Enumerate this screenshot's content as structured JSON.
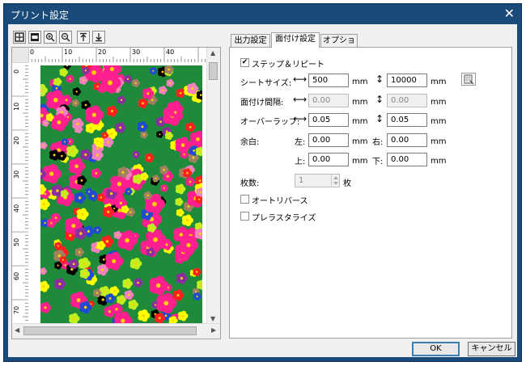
{
  "window": {
    "title": "プリント設定"
  },
  "toolbar": {
    "icons": [
      "fit-page-icon",
      "fit-width-icon",
      "zoom-in-icon",
      "zoom-out-icon",
      "align-top-icon",
      "align-bottom-icon"
    ]
  },
  "ruler": {
    "h_labels": [
      "0",
      "10",
      "20",
      "30",
      "40"
    ],
    "v_labels": [
      "0",
      "10",
      "20",
      "30",
      "40",
      "50",
      "60",
      "70"
    ]
  },
  "tabs": [
    {
      "label": "出力設定",
      "active": false
    },
    {
      "label": "面付け設定",
      "active": true
    },
    {
      "label": "オプション",
      "active": false
    }
  ],
  "step_repeat": {
    "label": "ステップ＆リピート",
    "checked": true
  },
  "sheet_size": {
    "label": "シートサイズ:",
    "width": "500",
    "height": "10000",
    "unit": "mm"
  },
  "imposition_spacing": {
    "label": "面付け間隔:",
    "width": "0.00",
    "height": "0.00",
    "unit": "mm"
  },
  "overlap": {
    "label": "オーバーラップ:",
    "width": "0.05",
    "height": "0.05",
    "unit": "mm"
  },
  "margins": {
    "label": "余白:",
    "left_label": "左:",
    "left": "0.00",
    "right_label": "右:",
    "right": "0.00",
    "top_label": "上:",
    "top": "0.00",
    "bottom_label": "下:",
    "bottom": "0.00",
    "unit": "mm"
  },
  "copies": {
    "label": "枚数:",
    "value": "1",
    "suffix": "枚"
  },
  "auto_reverse": {
    "label": "オートリバース",
    "checked": false
  },
  "pre_rasterize": {
    "label": "プレラスタライズ",
    "checked": false
  },
  "buttons": {
    "ok": "OK",
    "cancel": "キャンセル"
  },
  "colors": {
    "title_bar": "#1a4a7a",
    "pattern_background": "#1e8a3a",
    "flowers": [
      "#ff1f8f",
      "#ffff00",
      "#ff2020",
      "#000000",
      "#8b2ea0",
      "#f080c0",
      "#1e4bd0",
      "#a08060",
      "#c0f020"
    ]
  }
}
